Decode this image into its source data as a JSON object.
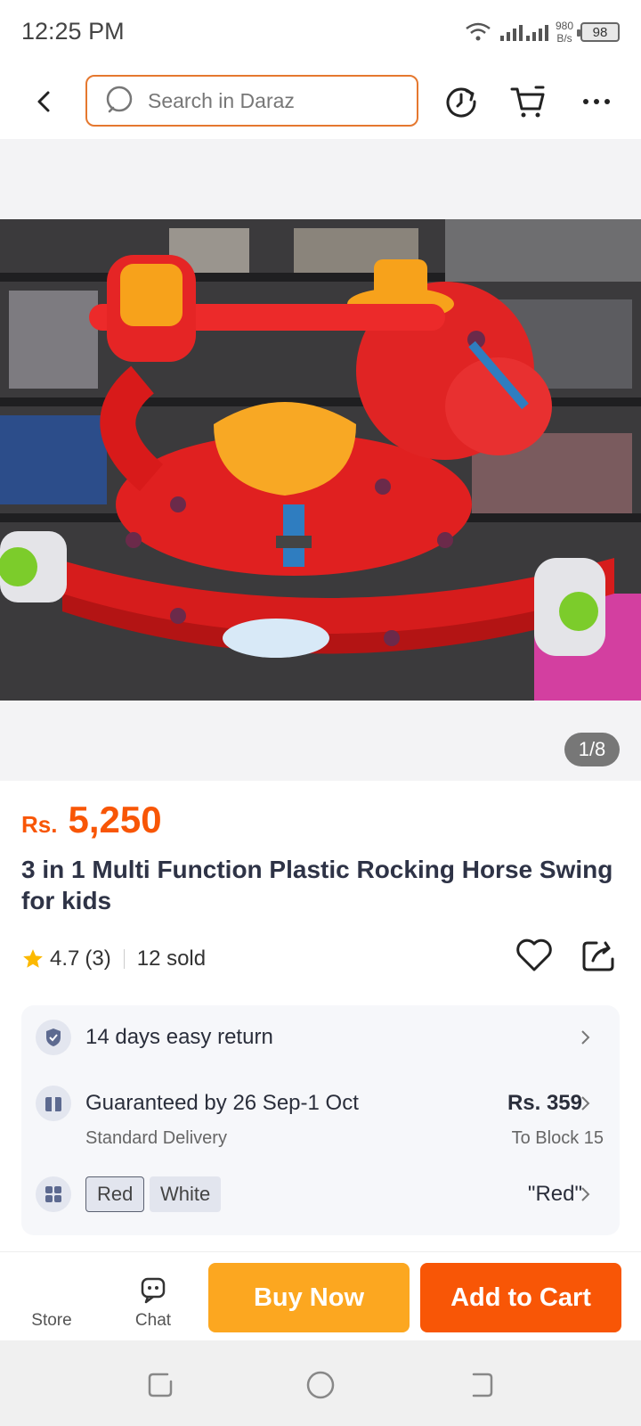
{
  "status_bar": {
    "time": "12:25 PM",
    "net_speed_value": "980",
    "net_speed_unit": "B/s",
    "battery": "98"
  },
  "header": {
    "search_placeholder": "Search in Daraz",
    "icons": [
      "back-arrow-icon",
      "search-icon",
      "refresh-icon",
      "cart-icon",
      "more-icon"
    ]
  },
  "gallery": {
    "counter": "1/8",
    "image_subject": "red plastic rocking horse toy with yellow seat"
  },
  "product": {
    "currency": "Rs.",
    "price": "5,250",
    "title": "3 in 1 Multi Function Plastic Rocking Horse Swing for kids",
    "rating": "4.7",
    "reviews": "(3)",
    "sold": "12 sold"
  },
  "info": {
    "return_text": "14 days easy return",
    "delivery_text": "Guaranteed by 26 Sep-1 Oct",
    "delivery_type": "Standard Delivery",
    "delivery_fee": "Rs. 359",
    "delivery_location": "To Block 15",
    "variants": [
      "Red",
      "White"
    ],
    "selected_variant": "\"Red\""
  },
  "bottom_bar": {
    "store_label": "Store",
    "chat_label": "Chat",
    "buy_now": "Buy Now",
    "add_to_cart": "Add to Cart"
  },
  "colors": {
    "accent": "#f85606",
    "buy_now": "#fca720",
    "search_border": "#e5782f"
  }
}
